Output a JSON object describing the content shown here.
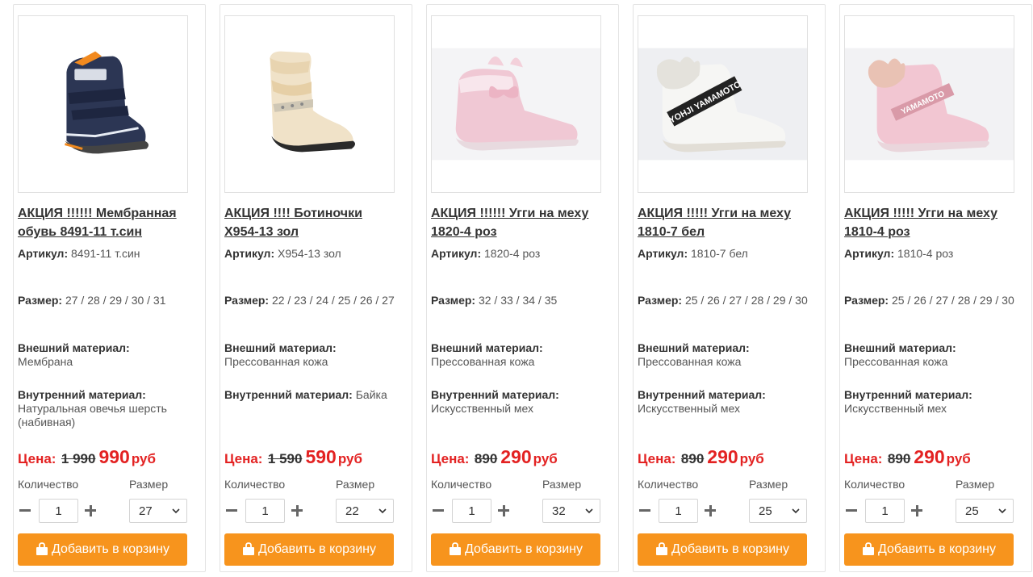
{
  "labels": {
    "sku": "Артикул:",
    "size": "Размер:",
    "outer": "Внешний материал:",
    "inner": "Внутренний материал:",
    "price": "Цена:",
    "currency": "руб",
    "quantity": "Количество",
    "size_select": "Размер",
    "add_to_cart": "Добавить в корзину"
  },
  "colors": {
    "accent_button": "#f7941d",
    "price_red": "#e32222"
  },
  "products": [
    {
      "title": "АКЦИЯ !!!!!! Мембранная обувь 8491-11 т.син",
      "sku": "8491-11 т.син",
      "sizes": "27 / 28 / 29 / 30 / 31",
      "outer": "Мембрана",
      "inner": "Натуральная овечья шерсть (набивная)",
      "old_price": "1 990",
      "new_price": "990",
      "quantity": "1",
      "selected_size": "27",
      "image_icon": "navy-membrane-boot"
    },
    {
      "title": "АКЦИЯ !!!! Ботиночки X954-13 зол",
      "sku": "X954-13 зол",
      "sizes": "22 / 23 / 24 / 25 / 26 / 27",
      "outer": "Прессованная кожа",
      "inner": "Байка",
      "old_price": "1 590",
      "new_price": "590",
      "quantity": "1",
      "selected_size": "22",
      "image_icon": "gold-ankle-boot"
    },
    {
      "title": "АКЦИЯ !!!!!! Угги на меху 1820-4 роз",
      "sku": "1820-4 роз",
      "sizes": "32 / 33 / 34 / 35",
      "outer": "Прессованная кожа",
      "inner": "Искусственный мех",
      "old_price": "890",
      "new_price": "290",
      "quantity": "1",
      "selected_size": "32",
      "image_icon": "pink-ugg-boot"
    },
    {
      "title": "АКЦИЯ !!!!! Угги на меху 1810-7 бел",
      "sku": "1810-7 бел",
      "sizes": "25 / 26 / 27 / 28 / 29 / 30",
      "outer": "Прессованная кожа",
      "inner": "Искусственный мех",
      "old_price": "890",
      "new_price": "290",
      "quantity": "1",
      "selected_size": "25",
      "image_icon": "white-ugg-boot",
      "brand_text": "YOHJI YAMAMOTO"
    },
    {
      "title": "АКЦИЯ !!!!! Угги на меху 1810-4 роз",
      "sku": "1810-4 роз",
      "sizes": "25 / 26 / 27 / 28 / 29 / 30",
      "outer": "Прессованная кожа",
      "inner": "Искусственный мех",
      "old_price": "890",
      "new_price": "290",
      "quantity": "1",
      "selected_size": "25",
      "image_icon": "pink-ugg-boot",
      "brand_text": "YAMAMOTO"
    }
  ]
}
